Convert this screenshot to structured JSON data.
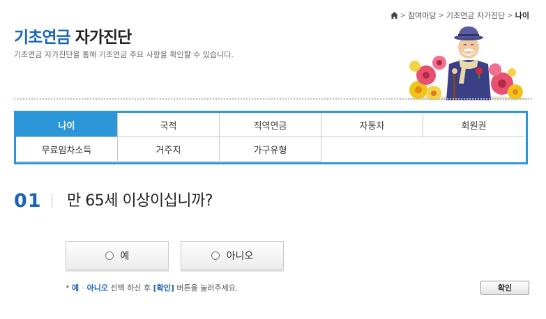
{
  "breadcrumb": {
    "items": [
      "참여마당",
      "기초연금 자가진단"
    ],
    "current": "나이",
    "home_icon": "home-icon"
  },
  "header": {
    "title_accent": "기초연금",
    "title_rest": "자가진단",
    "description": "기초연금 자가진단을 통해 기초연금 주요 사항을 확인할 수 있습니다."
  },
  "tabs": [
    {
      "label": "나이",
      "active": true
    },
    {
      "label": "국적",
      "active": false
    },
    {
      "label": "직역연금",
      "active": false
    },
    {
      "label": "자동차",
      "active": false
    },
    {
      "label": "회원권",
      "active": false
    },
    {
      "label": "무료임차소득",
      "active": false
    },
    {
      "label": "거주지",
      "active": false
    },
    {
      "label": "가구유형",
      "active": false
    }
  ],
  "question": {
    "number": "01",
    "text": "만 65세 이상이십니까?"
  },
  "options": {
    "yes": "예",
    "no": "아니오"
  },
  "note": {
    "prefix": "*",
    "yes": "예",
    "sep": "·",
    "no": "아니오",
    "middle": "선택 하신 후",
    "confirm_ref": "[확인]",
    "suffix": "버튼을 눌러주세요."
  },
  "confirm_button": "확인",
  "colors": {
    "accent": "#1a64b8",
    "tab_active": "#2b97d8",
    "tab_border": "#2b97d8"
  }
}
